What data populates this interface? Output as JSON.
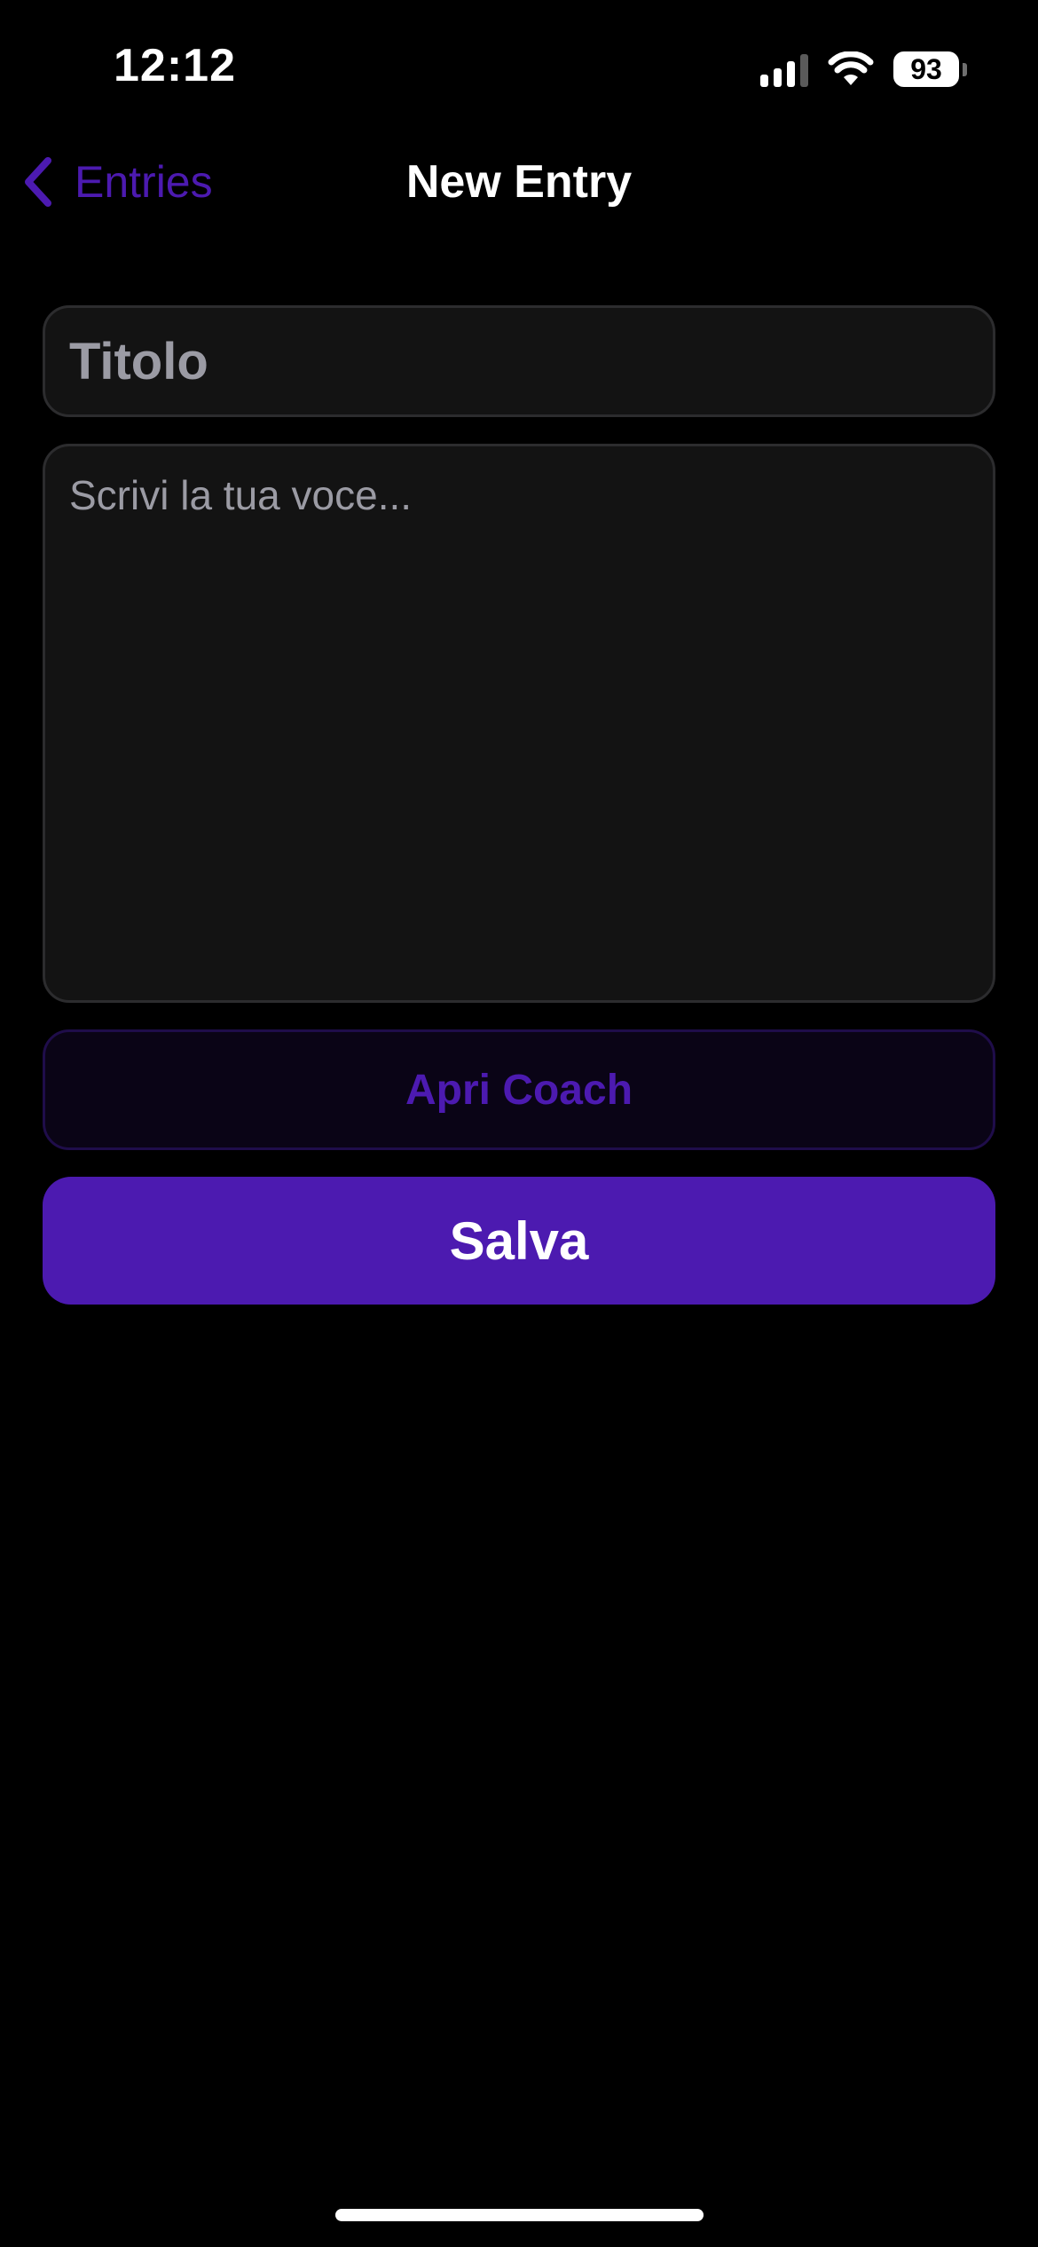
{
  "status_bar": {
    "time": "12:12",
    "battery": "93",
    "icons": [
      "signal-icon",
      "wifi-icon",
      "battery-icon"
    ]
  },
  "nav": {
    "back_label": "Entries",
    "back_icon": "chevron-left-icon",
    "title": "New Entry"
  },
  "form": {
    "title_placeholder": "Titolo",
    "title_value": "",
    "body_placeholder": "Scrivi la tua voce...",
    "body_value": "",
    "coach_button_label": "Apri Coach",
    "save_button_label": "Salva"
  },
  "colors": {
    "background": "#000000",
    "accent": "#4c1ab0",
    "field_background": "#131313",
    "field_border": "#2c2c2e",
    "placeholder": "#9b9ba4",
    "text": "#ffffff"
  }
}
